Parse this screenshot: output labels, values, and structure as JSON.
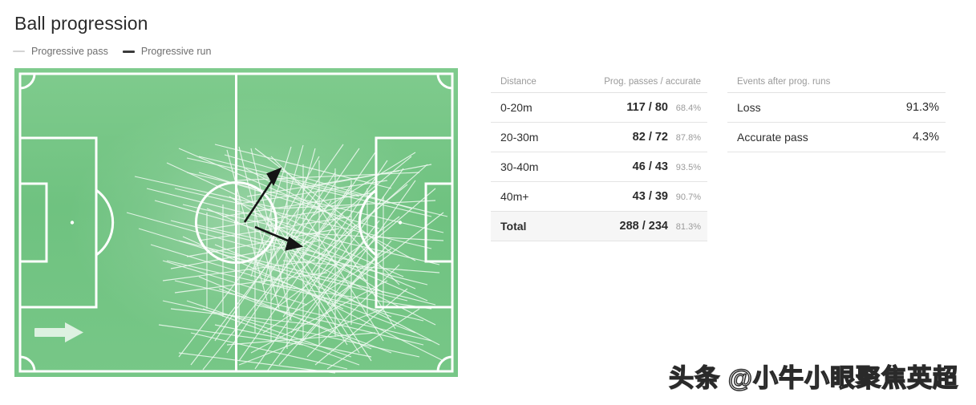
{
  "header": {
    "title": "Ball progression"
  },
  "legend": {
    "items": [
      {
        "label": "Progressive pass",
        "color": "#d3d3d3",
        "icon": "line-dash-icon"
      },
      {
        "label": "Progressive run",
        "color": "#3a3a3a",
        "icon": "line-dash-icon"
      }
    ]
  },
  "pitch": {
    "direction_arrow_label": "attacking direction",
    "grass_color": "#73c583",
    "line_color": "#ffffff",
    "pass_line_color": "#eaf7ee",
    "run_line_color": "#1d1d1d"
  },
  "tables": {
    "distance": {
      "columns": [
        "Distance",
        "Prog. passes / accurate"
      ],
      "rows": [
        {
          "label": "0-20m",
          "value": "117 / 80",
          "pct": "68.4%",
          "total": false
        },
        {
          "label": "20-30m",
          "value": "82 / 72",
          "pct": "87.8%",
          "total": false
        },
        {
          "label": "30-40m",
          "value": "46 / 43",
          "pct": "93.5%",
          "total": false
        },
        {
          "label": "40m+",
          "value": "43 / 39",
          "pct": "90.7%",
          "total": false
        },
        {
          "label": "Total",
          "value": "288 / 234",
          "pct": "81.3%",
          "total": true
        }
      ]
    },
    "events_after_runs": {
      "columns": [
        "Events after prog. runs",
        ""
      ],
      "rows": [
        {
          "label": "Loss",
          "pct": "91.3%"
        },
        {
          "label": "Accurate pass",
          "pct": "4.3%"
        }
      ]
    }
  },
  "chart_data": {
    "type": "table",
    "title": "Ball progression",
    "series": [
      {
        "name": "Prog. passes / accurate by distance",
        "categories": [
          "0-20m",
          "20-30m",
          "30-40m",
          "40m+",
          "Total"
        ],
        "attempted": [
          117,
          82,
          46,
          43,
          288
        ],
        "accurate": [
          80,
          72,
          43,
          39,
          234
        ],
        "accuracy_pct": [
          68.4,
          87.8,
          93.5,
          90.7,
          81.3
        ]
      },
      {
        "name": "Events after prog. runs",
        "categories": [
          "Loss",
          "Accurate pass"
        ],
        "values": [
          91.3,
          4.3
        ],
        "unit": "%"
      }
    ],
    "legend": [
      "Progressive pass",
      "Progressive run"
    ]
  },
  "watermark": {
    "text": "头条 @小牛小眼聚焦英超"
  }
}
